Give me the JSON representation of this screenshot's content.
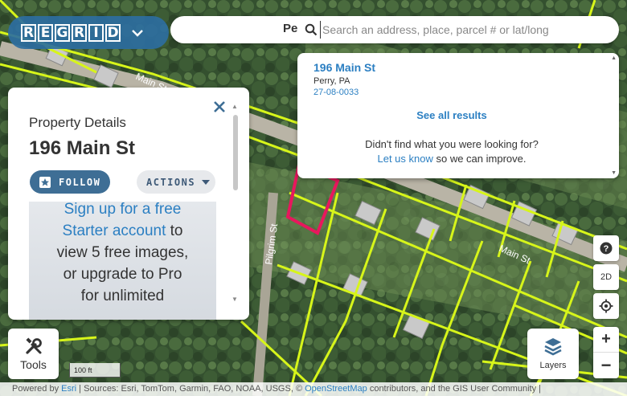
{
  "map": {
    "road_labels": [
      "Main St",
      "Pilgrim St",
      "Main St"
    ],
    "colors": {
      "parcel_line": "#d7f51a",
      "selected_parcel": "#e8175d",
      "road": "#b9b4a6"
    }
  },
  "logo": {
    "letters": [
      "R",
      "E",
      "G",
      "R",
      "I",
      "D"
    ],
    "chevron": "chevron-down-icon"
  },
  "search": {
    "prefix": "Pe",
    "placeholder": "Search an address, place, parcel # or lat/long"
  },
  "results": {
    "title": "196 Main St",
    "city": "Perry, PA",
    "parcel": "27-08-0033",
    "see_all": "See all results",
    "didnt_find": "Didn't find what you were looking for?",
    "let_us_know": "Let us know",
    "improve": " so we can improve."
  },
  "panel": {
    "label": "Property Details",
    "address": "196 Main St",
    "follow": "FOLLOW",
    "actions": "ACTIONS",
    "upsell": {
      "pre": "Sign up for a free",
      "highlight": "Starter account",
      "post_1": " to",
      "line_3": "view 5 free images,",
      "line_4": "or upgrade to Pro",
      "line_5": "for unlimited"
    }
  },
  "controls": {
    "help": "?",
    "mode": "2D",
    "zoom_in": "+",
    "zoom_out": "−"
  },
  "tools": {
    "label": "Tools"
  },
  "layers": {
    "label": "Layers"
  },
  "scale": {
    "text": "100 ft"
  },
  "attribution": {
    "powered": "Powered by ",
    "esri": "Esri",
    "sources": " | Sources: Esri, TomTom, Garmin, FAO, NOAA, USGS, © ",
    "osm": "OpenStreetMap",
    "rest": " contributors, and the GIS User Community |"
  }
}
